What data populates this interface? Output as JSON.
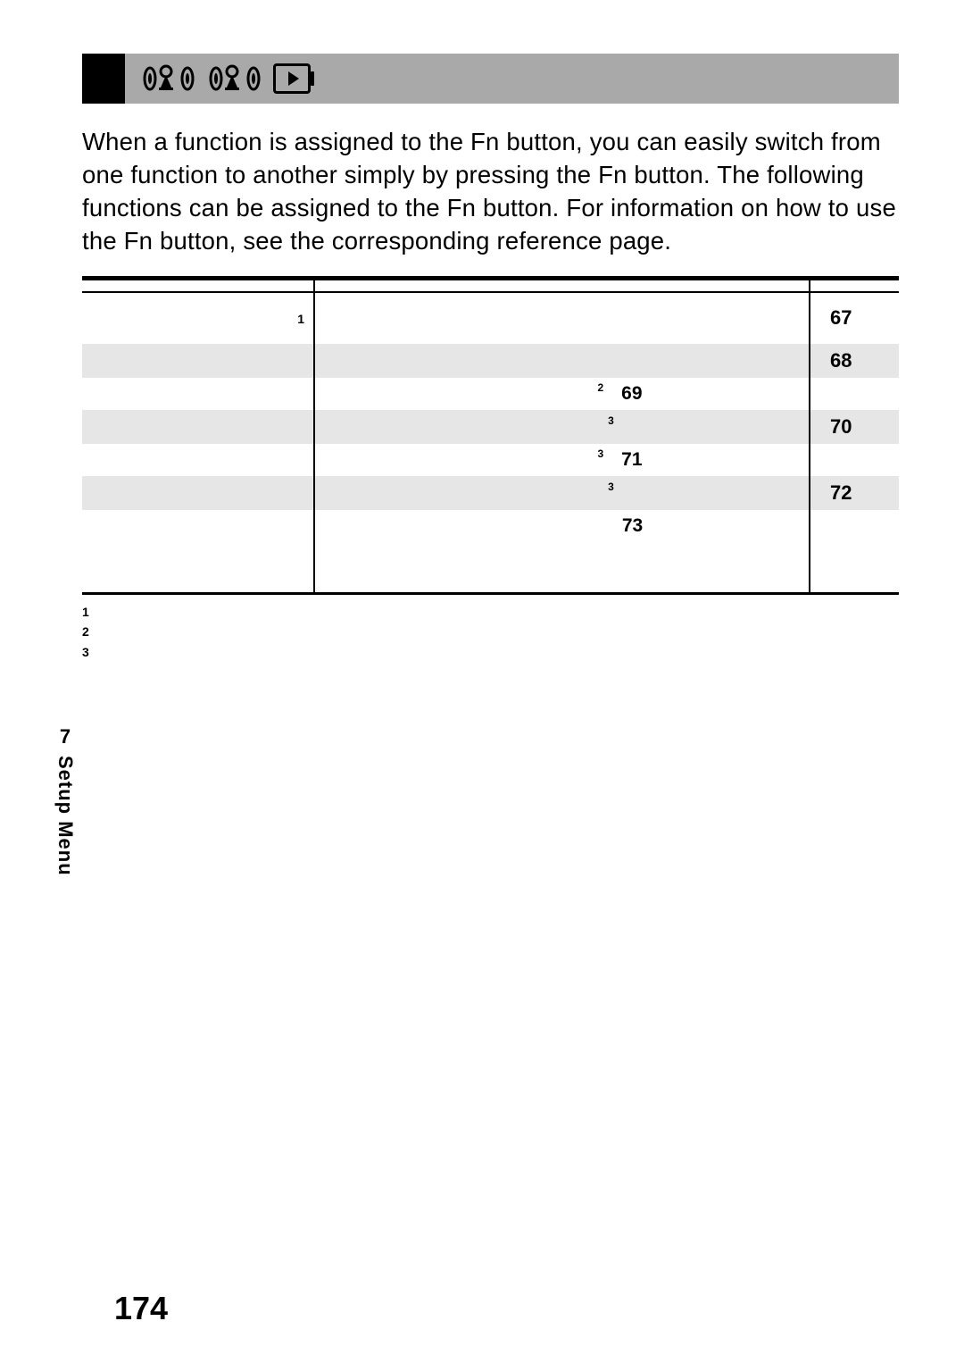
{
  "section": {
    "number": "7",
    "name": "Setup Menu"
  },
  "page_number": "174",
  "intro_text": "When a function is assigned to the Fn button, you can easily switch from one function to another simply by pressing the Fn button. The following functions can be assigned to the Fn button. For information on how to use the Fn button, see the corresponding reference page.",
  "table": {
    "rows": [
      {
        "shade": false,
        "tall": true,
        "col1_sup": "1",
        "col2_sup": "",
        "col2_num": "",
        "col3": "67"
      },
      {
        "shade": true,
        "tall": false,
        "col1_sup": "",
        "col2_sup": "",
        "col2_num": "",
        "col3": "68"
      },
      {
        "shade": false,
        "tall": false,
        "col1_sup": "",
        "col2_sup": "2",
        "col2_num": "69",
        "col3": ""
      },
      {
        "shade": true,
        "tall": false,
        "col1_sup": "",
        "col2_sup": "3",
        "col2_num": "",
        "col3": "70"
      },
      {
        "shade": false,
        "tall": false,
        "col1_sup": "",
        "col2_sup": "3",
        "col2_num": "71",
        "col3": ""
      },
      {
        "shade": true,
        "tall": false,
        "col1_sup": "",
        "col2_sup": "3",
        "col2_num": "",
        "col3": "72"
      },
      {
        "shade": false,
        "tall": false,
        "col1_sup": "",
        "col2_sup": "",
        "col2_num": "73",
        "col3": ""
      },
      {
        "shade": false,
        "tall": true,
        "col1_sup": "",
        "col2_sup": "",
        "col2_num": "",
        "col3": ""
      }
    ]
  },
  "footnotes": {
    "f1": "1",
    "f2": "2",
    "f3": "3"
  }
}
